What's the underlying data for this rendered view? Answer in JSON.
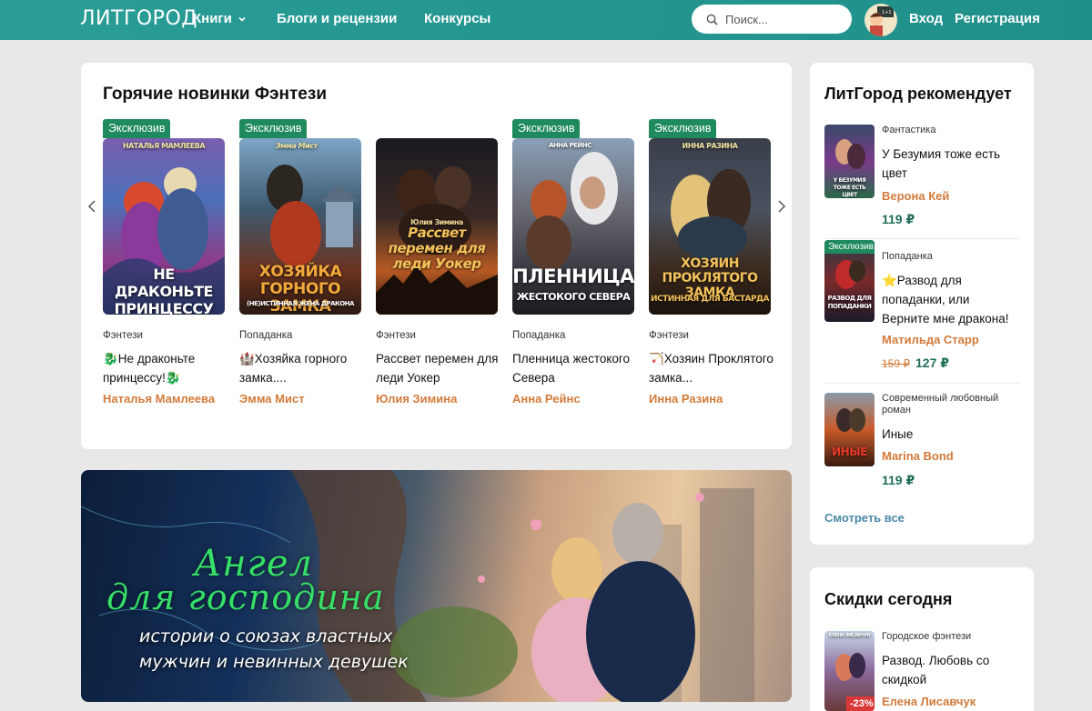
{
  "header": {
    "logo": "ЛИТГОРОД",
    "nav": [
      "Книги",
      "Блоги и рецензии",
      "Конкурсы"
    ],
    "search_placeholder": "Поиск...",
    "login": "Вход",
    "register": "Регистрация"
  },
  "hot_new": {
    "title": "Горячие новинки Фэнтези",
    "books": [
      {
        "badge": "Эксклюзив",
        "genre": "Фэнтези",
        "title": "🐉Не драконьте принцессу!🐉",
        "author": "Наталья Мамлеева",
        "cover_top": "НАТАЛЬЯ МАМЛЕЕВА",
        "cover_text": "НЕ ДРАКОНЬТЕ ПРИНЦЕССУ"
      },
      {
        "badge": "Эксклюзив",
        "genre": "Попаданка",
        "title": "🏰Хозяйка горного замка....",
        "author": "Эмма Мист",
        "cover_top": "Эмма Мист",
        "cover_text": "ХОЗЯЙКА ГОРНОГО ЗАМКА",
        "cover_sub": "(НЕ)ИСТИННАЯ ЖЕНА ДРАКОНА"
      },
      {
        "badge": "",
        "genre": "Фэнтези",
        "title": "Рассвет перемен для леди Уокер",
        "author": "Юлия Зимина",
        "cover_top": "Юлия Зимина",
        "cover_text": "Рассвет перемен для леди Уокер"
      },
      {
        "badge": "Эксклюзив",
        "genre": "Попаданка",
        "title": "Пленница жестокого Севера",
        "author": "Анна Рейнс",
        "cover_top": "АННА РЕЙНС",
        "cover_text": "ПЛЕННИЦА",
        "cover_sub": "ЖЕСТОКОГО СЕВЕРА"
      },
      {
        "badge": "Эксклюзив",
        "genre": "Фэнтези",
        "title": "🏹Хозяин Проклятого замка...",
        "author": "Инна Разина",
        "cover_top": "ИННА РАЗИНА",
        "cover_text": "ХОЗЯИН ПРОКЛЯТОГО ЗАМКА",
        "cover_sub": "ИСТИННАЯ ДЛЯ БАСТАРДА"
      }
    ]
  },
  "banner": {
    "title_line1": "Ангел",
    "title_line2": "для господина",
    "subtitle_line1": "истории о союзах властных",
    "subtitle_line2": "мужчин и невинных девушек"
  },
  "recommend": {
    "title": "ЛитГород рекомендует",
    "items": [
      {
        "badge": "",
        "genre": "Фантастика",
        "title": "У Безумия тоже есть цвет",
        "author": "Верона Кей",
        "price": "119 ₽",
        "old_price": "",
        "cover_text": "У БЕЗУМИЯ ТОЖЕ ЕСТЬ ЦВЕТ"
      },
      {
        "badge": "Эксклюзив",
        "genre": "Попаданка",
        "title": "⭐Развод для попаданки, или Верните мне дракона!",
        "author": "Матильда Старр",
        "price": "127 ₽",
        "old_price": "159 ₽",
        "cover_text": "РАЗВОД ДЛЯ ПОПАДАНКИ"
      },
      {
        "badge": "",
        "genre": "Современный любовный роман",
        "title": "Иные",
        "author": "Marina Bond",
        "price": "119 ₽",
        "old_price": "",
        "cover_text": "ИНЫЕ"
      }
    ],
    "see_all": "Смотреть все"
  },
  "discounts": {
    "title": "Скидки сегодня",
    "item": {
      "genre": "Городское фэнтези",
      "title": "Развод. Любовь со скидкой",
      "author": "Елена Лисавчук",
      "discount": "-23%",
      "cover_top": "ЕЛЕНА ЛИСАВЧУК"
    }
  },
  "colors": {
    "header": "#2a9d97",
    "badge": "#1f8a5e",
    "author": "#d27a3a",
    "price": "#1f6f5a",
    "discount": "#d93838"
  }
}
